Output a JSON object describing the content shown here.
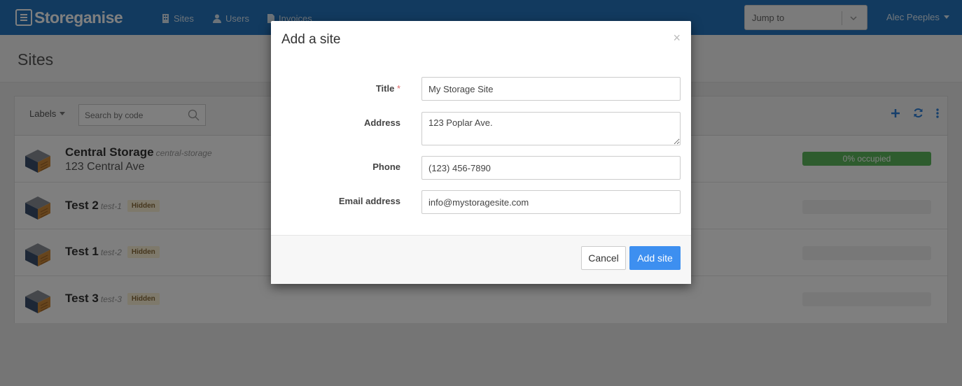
{
  "nav": {
    "brand": "Storeganise",
    "items": [
      {
        "label": "Sites",
        "icon": "building-icon"
      },
      {
        "label": "Users",
        "icon": "user-icon"
      },
      {
        "label": "Invoices",
        "icon": "document-icon"
      }
    ],
    "jump_to": "Jump to",
    "user": "Alec Peeples"
  },
  "page": {
    "title": "Sites",
    "toolbar": {
      "labels": "Labels",
      "search_placeholder": "Search by code"
    }
  },
  "sites": [
    {
      "name": "Central Storage",
      "code": "central-storage",
      "address": "123 Central Ave",
      "occupancy_label": "0% occupied",
      "occupancy": 1.0
    },
    {
      "name": "Test 2",
      "code": "test-1",
      "badge": "Hidden"
    },
    {
      "name": "Test 1",
      "code": "test-2",
      "badge": "Hidden"
    },
    {
      "name": "Test 3",
      "code": "test-3",
      "badge": "Hidden"
    }
  ],
  "modal": {
    "title": "Add a site",
    "close": "×",
    "fields": {
      "title": {
        "label": "Title",
        "required_mark": "*",
        "value": "My Storage Site"
      },
      "address": {
        "label": "Address",
        "value": "123 Poplar Ave."
      },
      "phone": {
        "label": "Phone",
        "value": "(123) 456-7890"
      },
      "email": {
        "label": "Email address",
        "value": "info@mystoragesite.com"
      }
    },
    "cancel": "Cancel",
    "submit": "Add site"
  },
  "colors": {
    "navbar": "#2475be",
    "primary_button": "#3d8ff0",
    "occupancy_bar": "#5cb85c",
    "required_mark": "#e06b6b",
    "hidden_badge_bg": "#fcf2d6"
  }
}
